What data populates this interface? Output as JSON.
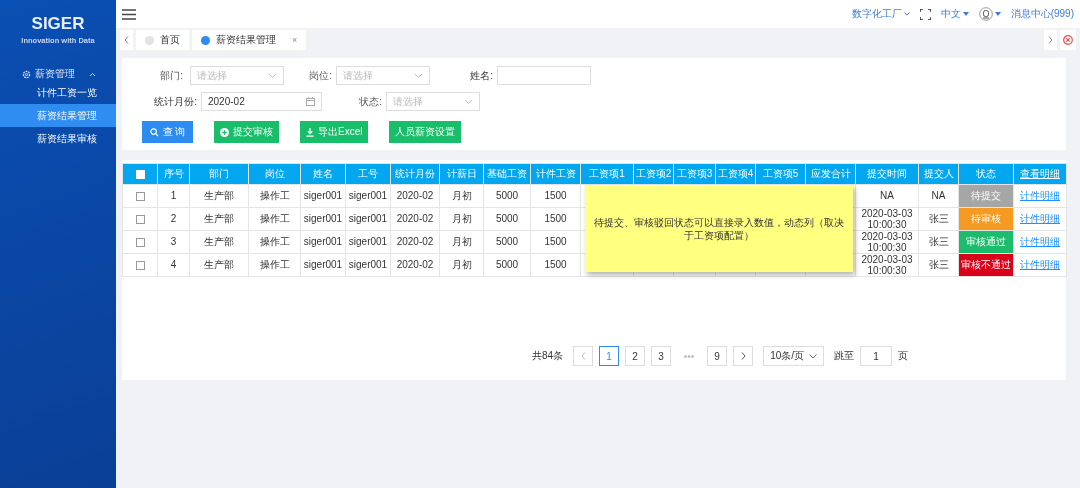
{
  "sidebar": {
    "logo": "SIGER",
    "tagline": "Innovation with Data",
    "groups": [
      {
        "label": "薪资管理",
        "expanded": true,
        "children": [
          {
            "label": "计件工资一览",
            "selected": false
          },
          {
            "label": "薪资结果管理",
            "selected": true
          },
          {
            "label": "薪资结果审核",
            "selected": false
          }
        ]
      }
    ]
  },
  "topbar": {
    "factory": "数字化工厂",
    "language": "中文",
    "messages": "消息中心(999)"
  },
  "tabs": [
    {
      "label": "首页",
      "selected": false,
      "closable": false
    },
    {
      "label": "薪资结果管理",
      "selected": true,
      "closable": true
    }
  ],
  "tab_close": "×",
  "filters": {
    "department": {
      "label": "部门:",
      "placeholder": "请选择"
    },
    "position": {
      "label": "岗位:",
      "placeholder": "请选择"
    },
    "name": {
      "label": "姓名:"
    },
    "month": {
      "label": "统计月份:",
      "value": "2020-02"
    },
    "status": {
      "label": "状态:",
      "placeholder": "请选择"
    }
  },
  "buttons": [
    {
      "label": "查 询",
      "kind": "search"
    },
    {
      "label": "提交审核",
      "kind": "submit"
    },
    {
      "label": "导出Excel",
      "kind": "export"
    },
    {
      "label": "人员薪资设置",
      "kind": "plain"
    }
  ],
  "table": {
    "header_checkbox": {
      "checked": false
    },
    "columns": [
      "序号",
      "部门",
      "岗位",
      "姓名",
      "工号",
      "统计月份",
      "计薪日",
      "基础工资",
      "计件工资",
      "工资项1",
      "工资项2",
      "工资项3",
      "工资项4",
      "工资项5",
      "应发合计",
      "提交时间",
      "提交人",
      "状态",
      "查看明细"
    ],
    "rows": [
      {
        "checked": false,
        "index": "1",
        "department": "生产部",
        "position": "操作工",
        "name": "siger001",
        "employee_id": "siger001",
        "month": "2020-02",
        "pay_day": "月初",
        "base_pay": "5000",
        "piece_pay": "1500",
        "submit_time": "NA",
        "submitter": "NA",
        "status": {
          "label": "待提交",
          "color": "#a6a6a6"
        },
        "detail": "计件明细"
      },
      {
        "checked": false,
        "index": "2",
        "department": "生产部",
        "position": "操作工",
        "name": "siger001",
        "employee_id": "siger001",
        "month": "2020-02",
        "pay_day": "月初",
        "base_pay": "5000",
        "piece_pay": "1500",
        "submit_time": "2020-03-03 10:00:30",
        "submitter": "张三",
        "status": {
          "label": "待审核",
          "color": "#f59a23"
        },
        "detail": "计件明细"
      },
      {
        "checked": false,
        "index": "3",
        "department": "生产部",
        "position": "操作工",
        "name": "siger001",
        "employee_id": "siger001",
        "month": "2020-02",
        "pay_day": "月初",
        "base_pay": "5000",
        "piece_pay": "1500",
        "submit_time": "2020-03-03 10:00:30",
        "submitter": "张三",
        "status": {
          "label": "审核通过",
          "color": "#1bbc6b"
        },
        "detail": "计件明细"
      },
      {
        "checked": false,
        "index": "4",
        "department": "生产部",
        "position": "操作工",
        "name": "siger001",
        "employee_id": "siger001",
        "month": "2020-02",
        "pay_day": "月初",
        "base_pay": "5000",
        "piece_pay": "1500",
        "submit_time": "2020-03-03 10:00:30",
        "submitter": "张三",
        "status": {
          "label": "审核不通过",
          "color": "#d9001b"
        },
        "detail": "计件明细"
      }
    ],
    "note": "待提交、审核驳回状态可以直接录入数值，动态列（取决于工资项配置）"
  },
  "pagination": {
    "total": "共84条",
    "pages": [
      {
        "label": "1",
        "selected": true
      },
      {
        "label": "2",
        "selected": false
      },
      {
        "label": "3",
        "selected": false
      },
      {
        "label": "•••",
        "kind": "ellipsis"
      },
      {
        "label": "9",
        "selected": false
      }
    ],
    "page_size": "10条/页",
    "jump_label": "跳至",
    "jump_value": "1",
    "jump_unit": "页"
  }
}
